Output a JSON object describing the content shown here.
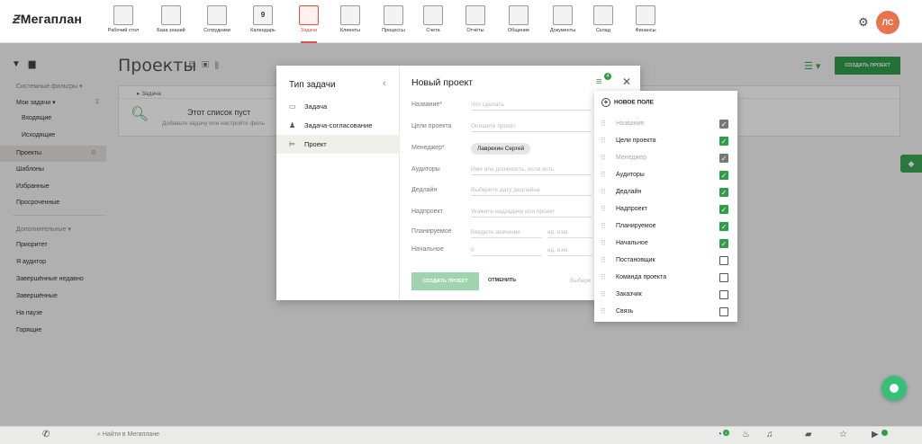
{
  "header": {
    "logo": "Мегаплан",
    "nav": [
      {
        "label": "Рабочий стол",
        "icon": "desktop-icon"
      },
      {
        "label": "База знаний",
        "icon": "knowledge-base-icon"
      },
      {
        "label": "Сотрудники",
        "icon": "employees-icon"
      },
      {
        "label": "Календарь",
        "icon": "calendar-icon",
        "badge": "9"
      },
      {
        "label": "Задачи",
        "icon": "tasks-icon",
        "active": true
      },
      {
        "label": "Клиенты",
        "icon": "clients-icon"
      },
      {
        "label": "Процессы",
        "icon": "processes-icon"
      },
      {
        "label": "Счета",
        "icon": "invoices-icon"
      },
      {
        "label": "Отчёты",
        "icon": "reports-icon"
      },
      {
        "label": "Общение",
        "icon": "chat-icon"
      },
      {
        "label": "Документы",
        "icon": "documents-icon"
      },
      {
        "label": "Склад",
        "icon": "warehouse-icon"
      },
      {
        "label": "Финансы",
        "icon": "finance-icon"
      }
    ],
    "avatar_initials": "ЛС"
  },
  "sidebar": {
    "system_filters": "Системные фильтры",
    "my_tasks": "Мои задачи",
    "my_tasks_count": "2",
    "incoming": "Входящие",
    "outgoing": "Исходящие",
    "projects": "Проекты",
    "projects_count": "0",
    "templates": "Шаблоны",
    "favorites": "Избранные",
    "overdue": "Просроченные",
    "additional": "Дополнительные",
    "priority": "Приоритет",
    "i_auditor": "Я аудитор",
    "recent": "Завершённые недавно",
    "completed": "Завершённые",
    "paused": "На паузе",
    "urgent": "Горящие"
  },
  "main": {
    "title": "Проекты",
    "create_button": "СОЗДАТЬ ПРОЕКТ",
    "column": "Задача",
    "empty_title": "Этот список пуст",
    "empty_subtitle": "Добавьте задачу или настройте филь"
  },
  "modal": {
    "type_title": "Тип задачи",
    "types": [
      {
        "label": "Задача",
        "icon": "task-icon"
      },
      {
        "label": "Задача-согласование",
        "icon": "approval-task-icon"
      },
      {
        "label": "Проект",
        "icon": "project-icon",
        "active": true
      }
    ],
    "title": "Новый проект",
    "columns_badge": "4",
    "fields": {
      "name": {
        "label": "Название",
        "placeholder": "Что сделать"
      },
      "goals": {
        "label": "Цели проекта",
        "placeholder": "Опишите проект"
      },
      "manager": {
        "label": "Менеджер",
        "value": "Лаврехин Сергей"
      },
      "auditors": {
        "label": "Аудиторы",
        "placeholder": "Имя или должность, если есть"
      },
      "deadline": {
        "label": "Дедлайн",
        "placeholder": "Выберите дату дедлайна"
      },
      "parent": {
        "label": "Надпроект",
        "placeholder": "Укажите надзадачу или проект"
      },
      "planned": {
        "label": "Планируемое",
        "placeholder": "Введите значение",
        "unit_placeholder": "ед. изм."
      },
      "initial": {
        "label": "Начальное",
        "placeholder": "0",
        "unit_placeholder": "ед. изм."
      }
    },
    "create_button": "СОЗДАТЬ ПРОЕКТ",
    "cancel_button": "ОТМЕНИТЬ",
    "select_placeholder": "Выбери"
  },
  "dropdown": {
    "new_field": "НОВОЕ ПОЛЕ",
    "items": [
      {
        "label": "Название",
        "checked": true,
        "disabled": true
      },
      {
        "label": "Цели проекта",
        "checked": true,
        "disabled": false
      },
      {
        "label": "Менеджер",
        "checked": true,
        "disabled": true
      },
      {
        "label": "Аудиторы",
        "checked": true,
        "disabled": false
      },
      {
        "label": "Дедлайн",
        "checked": true,
        "disabled": false
      },
      {
        "label": "Надпроект",
        "checked": true,
        "disabled": false
      },
      {
        "label": "Планируемое",
        "checked": true,
        "disabled": false
      },
      {
        "label": "Начальное",
        "checked": true,
        "disabled": false
      },
      {
        "label": "Постановщик",
        "checked": false,
        "disabled": false
      },
      {
        "label": "Команда проекта",
        "checked": false,
        "disabled": false
      },
      {
        "label": "Заказчик",
        "checked": false,
        "disabled": false
      },
      {
        "label": "Связь",
        "checked": false,
        "disabled": false
      }
    ]
  },
  "bottombar": {
    "search_placeholder": "Найти в Мегаплане",
    "notifications_badge": "2"
  }
}
